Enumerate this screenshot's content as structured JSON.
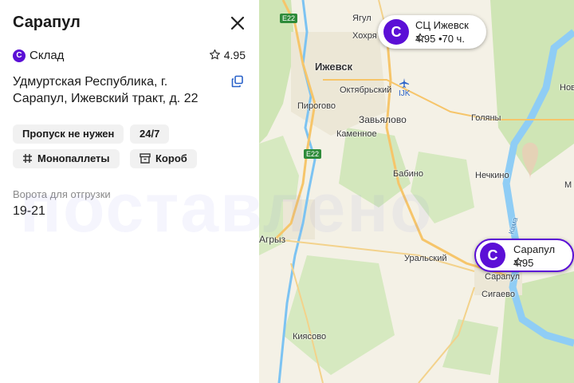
{
  "panel": {
    "title": "Сарапул",
    "type_badge_letter": "С",
    "type_label": "Склад",
    "rating": "4.95",
    "address": "Удмуртская Республика, г. Сарапул, Ижевский тракт, д. 22",
    "chips": [
      "Пропуск не нужен",
      "24/7",
      "Монопаллеты",
      "Короб"
    ],
    "gate_label": "Ворота для отгрузки",
    "gate_value": "19-21",
    "icons": [
      "close-icon",
      "star-icon",
      "copy-icon",
      "pallet-icon",
      "box-icon"
    ]
  },
  "map": {
    "labels": {
      "yagul": "Ягул",
      "khokhryaki": "Хохря",
      "izhevsk": "Ижевск",
      "oktyabrsky": "Октябрьский",
      "pirogovo": "Пирогово",
      "zavyalovo": "Завьялово",
      "kamennoe": "Каменное",
      "golyany": "Голяны",
      "babino": "Бабино",
      "nechkino": "Нечкино",
      "agryz": "Агрыз",
      "uralsky": "Уральский",
      "sarapul": "Сарапул",
      "sigaevo": "Сигаево",
      "kiyasovo": "Киясово",
      "kama": "Кама",
      "novo": "Нов",
      "ma": "М"
    },
    "roads": [
      "E22",
      "E22"
    ],
    "airport_code": "IJK",
    "pins": [
      {
        "letter": "С",
        "name": "СЦ Ижевск",
        "rating": "4.95",
        "extra": "•70 ч."
      },
      {
        "letter": "С",
        "name": "Сарапул",
        "rating": "4.95"
      }
    ],
    "watermark": "поставлено",
    "colors": {
      "brand": "#5b0fd6",
      "water": "#7cc3f2",
      "forest": "#cfe5b5",
      "road": "#f6c56a"
    }
  }
}
